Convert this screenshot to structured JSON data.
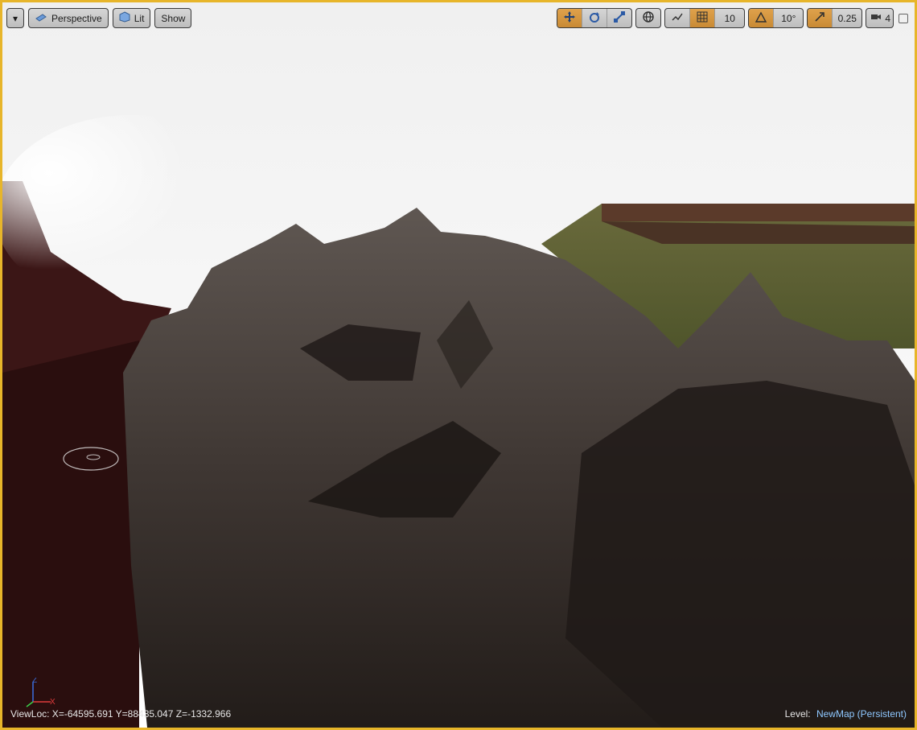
{
  "toolbar": {
    "menu_caret": "▾",
    "perspective_label": "Perspective",
    "lit_label": "Lit",
    "show_label": "Show"
  },
  "transform_tools": {
    "translate_icon": "move-icon",
    "rotate_icon": "rotate-icon",
    "scale_icon": "scale-icon",
    "world_icon": "globe-icon"
  },
  "snapping": {
    "grid_snap_value": "10",
    "rotation_snap_value": "10°",
    "scale_snap_value": "0.25",
    "camera_speed_value": "4"
  },
  "status": {
    "view_location": "ViewLoc: X=-64595.691 Y=88435.047 Z=-1332.966",
    "level_label": "Level:",
    "level_name": "NewMap (Persistent)"
  },
  "axis_labels": {
    "x": "X",
    "z": "Z"
  },
  "colors": {
    "accent_border": "#e7b52a",
    "active_toggle": "#d49742"
  }
}
